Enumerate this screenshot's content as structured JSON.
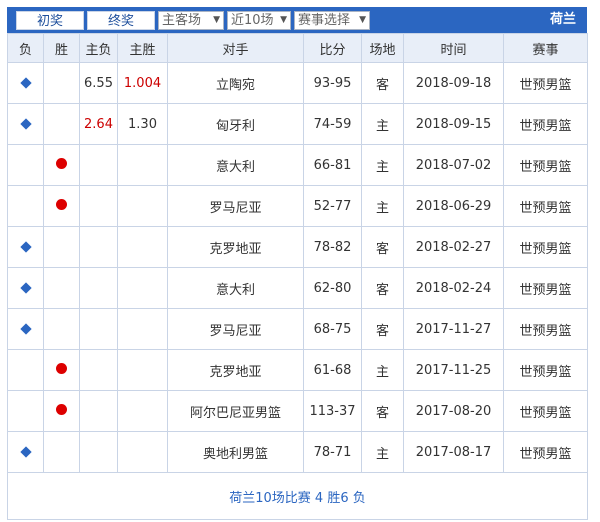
{
  "toolbar": {
    "btn_initial": "初奖",
    "btn_final": "终奖",
    "select_venue": "主客场",
    "select_range": "近10场",
    "select_event": "赛事选择",
    "team": "荷兰"
  },
  "headers": [
    "负",
    "胜",
    "主负",
    "主胜",
    "对手",
    "比分",
    "场地",
    "时间",
    "赛事"
  ],
  "rows": [
    {
      "result": "负",
      "home_loss": "6.55",
      "home_win": "1.004",
      "opponent": "立陶宛",
      "score": "93-95",
      "venue": "客",
      "date": "2018-09-18",
      "event": "世预男篮"
    },
    {
      "result": "负",
      "home_loss": "2.64",
      "home_win": "1.30",
      "opponent": "匈牙利",
      "score": "74-59",
      "venue": "主",
      "date": "2018-09-15",
      "event": "世预男篮"
    },
    {
      "result": "胜",
      "home_loss": "",
      "home_win": "",
      "opponent": "意大利",
      "score": "66-81",
      "venue": "主",
      "date": "2018-07-02",
      "event": "世预男篮"
    },
    {
      "result": "胜",
      "home_loss": "",
      "home_win": "",
      "opponent": "罗马尼亚",
      "score": "52-77",
      "venue": "主",
      "date": "2018-06-29",
      "event": "世预男篮"
    },
    {
      "result": "负",
      "home_loss": "",
      "home_win": "",
      "opponent": "克罗地亚",
      "score": "78-82",
      "venue": "客",
      "date": "2018-02-27",
      "event": "世预男篮"
    },
    {
      "result": "负",
      "home_loss": "",
      "home_win": "",
      "opponent": "意大利",
      "score": "62-80",
      "venue": "客",
      "date": "2018-02-24",
      "event": "世预男篮"
    },
    {
      "result": "负",
      "home_loss": "",
      "home_win": "",
      "opponent": "罗马尼亚",
      "score": "68-75",
      "venue": "客",
      "date": "2017-11-27",
      "event": "世预男篮"
    },
    {
      "result": "胜",
      "home_loss": "",
      "home_win": "",
      "opponent": "克罗地亚",
      "score": "61-68",
      "venue": "主",
      "date": "2017-11-25",
      "event": "世预男篮"
    },
    {
      "result": "胜",
      "home_loss": "",
      "home_win": "",
      "opponent": "阿尔巴尼亚男篮",
      "score": "113-37",
      "venue": "客",
      "date": "2017-08-20",
      "event": "世预男篮"
    },
    {
      "result": "负",
      "home_loss": "",
      "home_win": "",
      "opponent": "奥地利男篮",
      "score": "78-71",
      "venue": "主",
      "date": "2017-08-17",
      "event": "世预男篮"
    }
  ],
  "summary": "荷兰10场比赛 4 胜6 负",
  "colors": {
    "accent": "#2b66c1",
    "win_dot": "#dd0000",
    "loss_marker": "#2b66c1",
    "odds_red": "#cc0000"
  },
  "icons": {
    "loss_marker": "diamond-icon",
    "win_marker": "red-dot-icon",
    "dropdown": "triangle-down-icon"
  }
}
